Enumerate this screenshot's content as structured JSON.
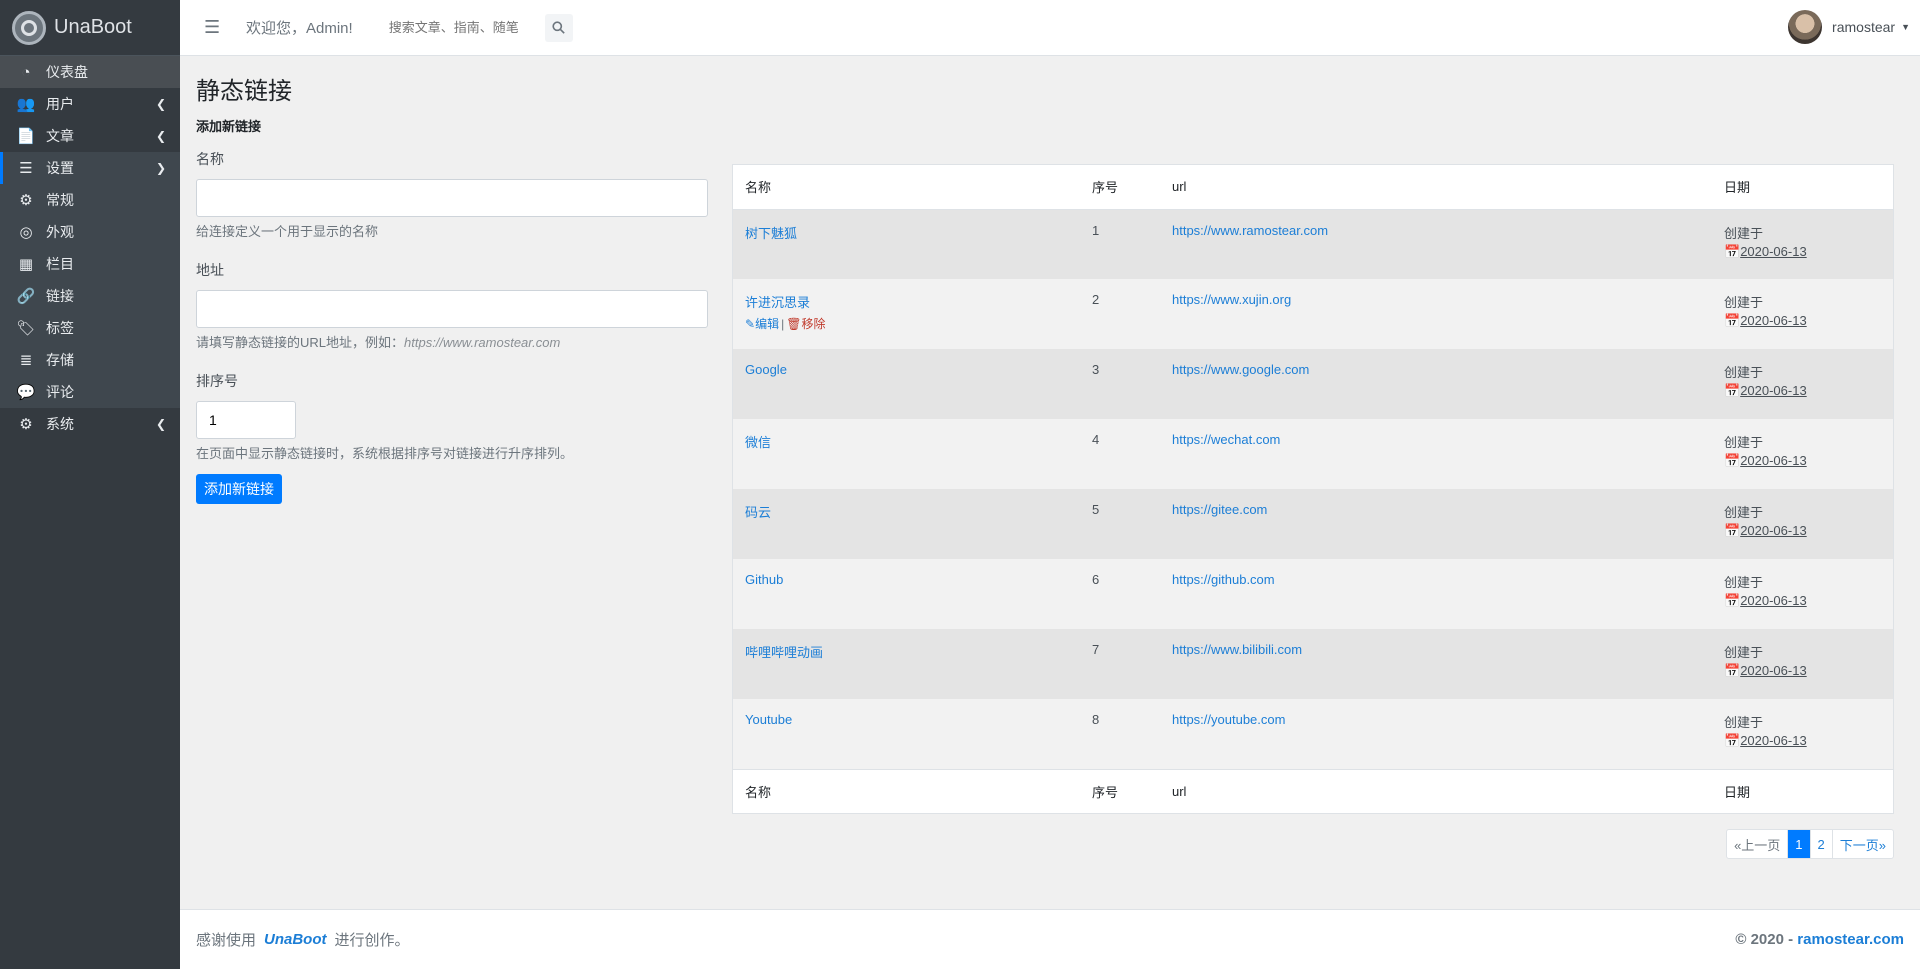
{
  "brand": {
    "name": "UnaBoot"
  },
  "sidebar": {
    "items": [
      {
        "label": "仪表盘",
        "icon": "dashboard-icon",
        "glyph": "◔"
      },
      {
        "label": "用户",
        "icon": "users-icon",
        "glyph": "👥"
      },
      {
        "label": "文章",
        "icon": "document-icon",
        "glyph": "📄"
      },
      {
        "label": "设置",
        "icon": "sliders-icon",
        "glyph": "☰"
      },
      {
        "label": "常规",
        "icon": "gear-icon",
        "glyph": "⚙"
      },
      {
        "label": "外观",
        "icon": "chrome-icon",
        "glyph": "◎"
      },
      {
        "label": "栏目",
        "icon": "grid-icon",
        "glyph": "▦"
      },
      {
        "label": "链接",
        "icon": "link-icon",
        "glyph": "🔗"
      },
      {
        "label": "标签",
        "icon": "tag-icon",
        "glyph": "🏷"
      },
      {
        "label": "存储",
        "icon": "server-icon",
        "glyph": "≣"
      },
      {
        "label": "评论",
        "icon": "comments-icon",
        "glyph": "💬"
      },
      {
        "label": "系统",
        "icon": "cogs-icon",
        "glyph": "⚙"
      }
    ]
  },
  "header": {
    "welcome": "欢迎您，Admin!",
    "search_placeholder": "搜索文章、指南、随笔",
    "user_name": "ramostear"
  },
  "page": {
    "title": "静态链接",
    "section_title": "添加新链接"
  },
  "form": {
    "name_label": "名称",
    "name_hint": "给连接定义一个用于显示的名称",
    "url_label": "地址",
    "url_hint_prefix": "请填写静态链接的URL地址，例如：",
    "url_hint_example": "https://www.ramostear.com",
    "order_label": "排序号",
    "order_value": "1",
    "order_hint": "在页面中显示静态链接时，系统根据排序号对链接进行升序排列。",
    "submit_label": "添加新链接"
  },
  "table": {
    "headers": {
      "name": "名称",
      "order": "序号",
      "url": "url",
      "date": "日期"
    },
    "created_label": "创建于",
    "edit_label": "编辑",
    "remove_label": "移除",
    "rows": [
      {
        "name": "树下魅狐",
        "order": "1",
        "url": "https://www.ramostear.com",
        "date": "2020-06-13"
      },
      {
        "name": "许进沉思录",
        "order": "2",
        "url": "https://www.xujin.org",
        "date": "2020-06-13"
      },
      {
        "name": "Google",
        "order": "3",
        "url": "https://www.google.com",
        "date": "2020-06-13"
      },
      {
        "name": "微信",
        "order": "4",
        "url": "https://wechat.com",
        "date": "2020-06-13"
      },
      {
        "name": "码云",
        "order": "5",
        "url": "https://gitee.com",
        "date": "2020-06-13"
      },
      {
        "name": "Github",
        "order": "6",
        "url": "https://github.com",
        "date": "2020-06-13"
      },
      {
        "name": "哔哩哔哩动画",
        "order": "7",
        "url": "https://www.bilibili.com",
        "date": "2020-06-13"
      },
      {
        "name": "Youtube",
        "order": "8",
        "url": "https://youtube.com",
        "date": "2020-06-13"
      }
    ]
  },
  "pagination": {
    "prev": "«上一页",
    "pages": [
      "1",
      "2"
    ],
    "current": "1",
    "next": "下一页»"
  },
  "footer": {
    "prefix": "感谢使用",
    "brand": "UnaBoot",
    "suffix": "进行创作。",
    "copyright": "© 2020 - ",
    "site": "ramostear.com"
  }
}
